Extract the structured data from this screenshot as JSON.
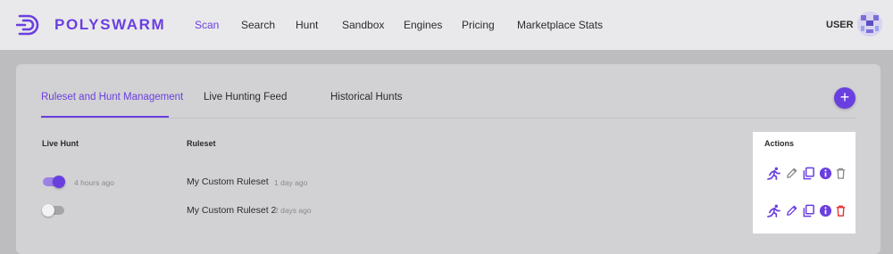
{
  "app": {
    "brand": "POLYSWARM",
    "nav": [
      "Scan",
      "Search",
      "Hunt",
      "Sandbox",
      "Engines",
      "Pricing",
      "Marketplace Stats"
    ],
    "active_nav": "Scan",
    "user_label": "USER"
  },
  "tabs": [
    "Ruleset and Hunt Management",
    "Live Hunting Feed",
    "Historical Hunts"
  ],
  "active_tab": "Ruleset and Hunt Management",
  "add_button_label": "+",
  "table": {
    "headers": {
      "live_hunt": "Live Hunt",
      "ruleset": "Ruleset",
      "actions": "Actions"
    },
    "rows": [
      {
        "live_hunt_on": true,
        "live_hunt_time": "4 hours ago",
        "ruleset": "My Custom Ruleset",
        "ruleset_time": "1 day ago"
      },
      {
        "live_hunt_on": false,
        "live_hunt_time": "",
        "ruleset": "My Custom Ruleset 2",
        "ruleset_time": "2 days ago"
      }
    ]
  },
  "action_icons": [
    "run-hunt-icon",
    "edit-icon",
    "copy-icon",
    "info-icon",
    "delete-icon"
  ],
  "colors": {
    "accent": "#6a3fe0",
    "delete_enabled": "#e53935",
    "delete_disabled": "#8a8a8c"
  }
}
